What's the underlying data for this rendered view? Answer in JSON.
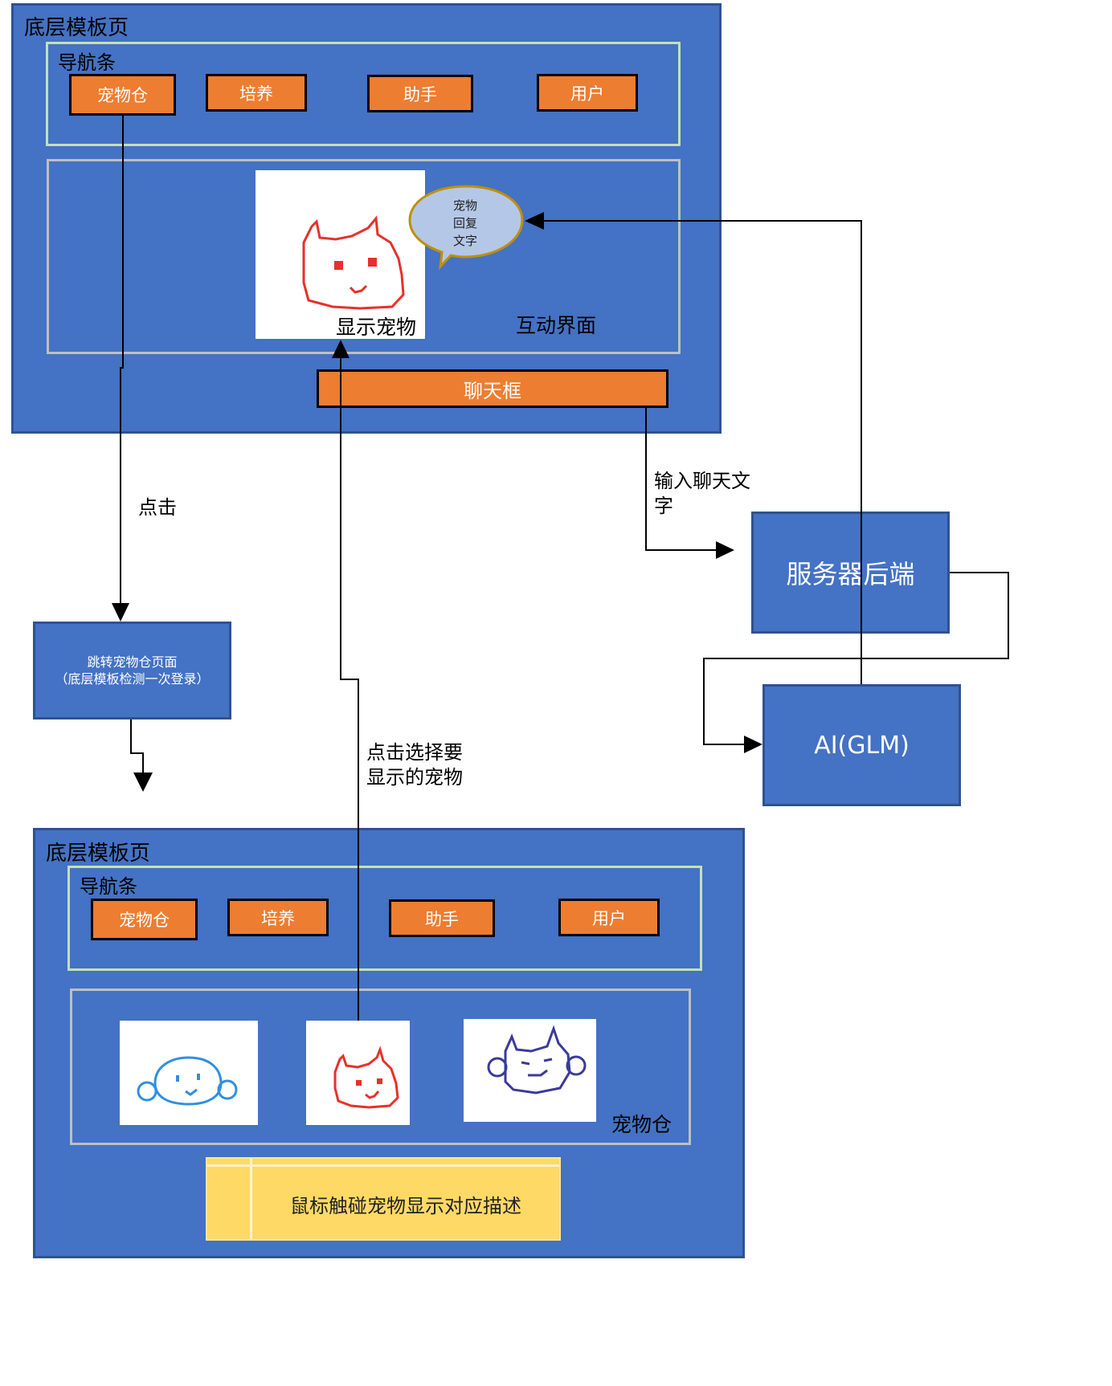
{
  "top": {
    "page_label": "底层模板页",
    "nav_label": "导航条",
    "nav_buttons": [
      "宠物仓",
      "培养",
      "助手",
      "用户"
    ],
    "pet_caption": "显示宠物",
    "bubble_lines": [
      "宠物",
      "回复",
      "文字"
    ],
    "interaction_label": "互动界面",
    "chat_box": "聊天框"
  },
  "flow": {
    "click_label": "点击",
    "jump_box_line1": "跳转宠物仓页面",
    "jump_box_line2": "（底层模板检测一次登录）",
    "select_label_line1": "点击选择要",
    "select_label_line2": "显示的宠物",
    "chat_input_line1": "输入聊天文",
    "chat_input_line2": "字",
    "server": "服务器后端",
    "ai": "AI(GLM)"
  },
  "bottom": {
    "page_label": "底层模板页",
    "nav_label": "导航条",
    "nav_buttons": [
      "宠物仓",
      "培养",
      "助手",
      "用户"
    ],
    "warehouse_label": "宠物仓",
    "hover_desc": "鼠标触碰宠物显示对应描述"
  },
  "colors": {
    "panel": "#4472c4",
    "button": "#ed7d31",
    "nav_border": "#c5e0b4",
    "area_border": "#bfbfbf",
    "tooltip": "#ffd966",
    "pet_red": "#e8302a",
    "pet_blue": "#2f8fe0",
    "pet_purple": "#3b3a9a",
    "bubble_fill": "#b4c7e7",
    "bubble_border": "#bf9000"
  },
  "icons": [
    "red-cat-pet-icon",
    "blue-blob-pet-icon",
    "purple-cat-pet-icon",
    "speech-bubble-icon"
  ]
}
